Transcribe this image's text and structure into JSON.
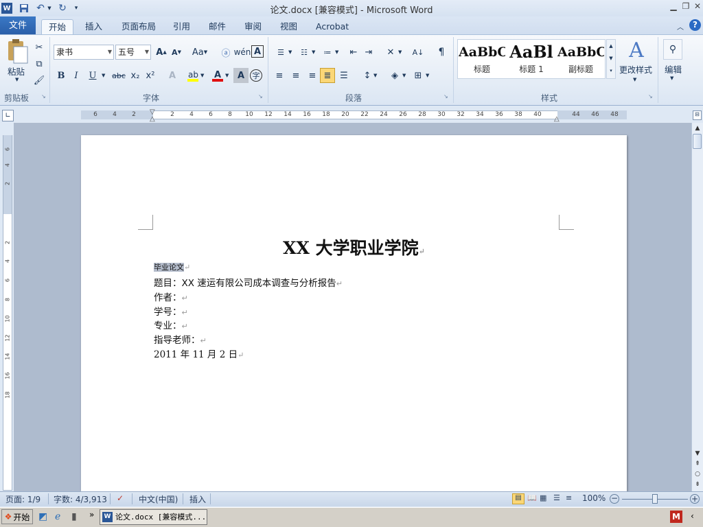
{
  "app": {
    "title": "论文.docx [兼容模式]  -  Microsoft Word",
    "icon": "word-app-icon"
  },
  "tabs": [
    "文件",
    "开始",
    "插入",
    "页面布局",
    "引用",
    "邮件",
    "审阅",
    "视图",
    "Acrobat"
  ],
  "active_tab": "开始",
  "clipboard": {
    "paste_label": "粘贴",
    "group_label": "剪贴板"
  },
  "font": {
    "name": "隶书",
    "size": "五号",
    "group_label": "字体",
    "grow": "A",
    "shrink": "A",
    "case": "Aa",
    "bold": "B",
    "italic": "I",
    "underline": "U",
    "strike": "abc",
    "sub": "x₂",
    "sup": "x²",
    "font_color": "A",
    "char_shading": "A",
    "enclose": "字"
  },
  "paragraph": {
    "group_label": "段落"
  },
  "styles": {
    "group_label": "样式",
    "items": [
      {
        "preview": "AaBbC",
        "name": "标题"
      },
      {
        "preview": "AaBl",
        "name": "标题 1"
      },
      {
        "preview": "AaBbC",
        "name": "副标题"
      }
    ],
    "change_styles_label": "更改样式"
  },
  "editing": {
    "label": "编辑"
  },
  "ruler": {
    "h_ticks": [
      "6",
      "4",
      "2",
      "2",
      "4",
      "6",
      "8",
      "10",
      "12",
      "14",
      "16",
      "18",
      "20",
      "22",
      "24",
      "26",
      "28",
      "30",
      "32",
      "34",
      "36",
      "38",
      "40",
      "44",
      "46",
      "48"
    ],
    "v_ticks": [
      "6",
      "4",
      "2",
      "2",
      "4",
      "6",
      "8",
      "10",
      "12",
      "14",
      "16",
      "18"
    ]
  },
  "document": {
    "title": "XX 大学职业学院",
    "lines": [
      "毕业论文",
      "题目：XX 速运有限公司成本调查与分析报告",
      "作者：",
      "学号：",
      "专业：",
      "指导老师：",
      "2011 年 11 月 2 日"
    ],
    "para_mark": "↵"
  },
  "status": {
    "page": "页面: 1/9",
    "words": "字数: 4/3,913",
    "language": "中文(中国)",
    "mode": "插入",
    "zoom": "100%"
  },
  "taskbar": {
    "start": "开始",
    "item": "论文.docx [兼容模式..."
  },
  "colors": {
    "file_tab": "#2a5ea8",
    "highlight_yellow": "#ffff00",
    "font_red": "#e01010",
    "selection": "#b4bccb"
  }
}
